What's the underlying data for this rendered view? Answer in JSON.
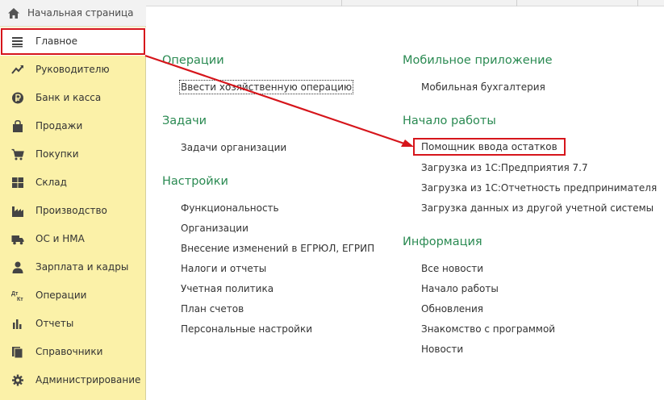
{
  "sidebar": {
    "home": {
      "label": "Начальная страница",
      "icon": "home-icon"
    },
    "items": [
      {
        "label": "Главное",
        "icon": "hamburger-menu-icon",
        "active": true
      },
      {
        "label": "Руководителю",
        "icon": "trend-chart-icon"
      },
      {
        "label": "Банк и касса",
        "icon": "ruble-coin-icon"
      },
      {
        "label": "Продажи",
        "icon": "shopping-bag-icon"
      },
      {
        "label": "Покупки",
        "icon": "shopping-cart-icon"
      },
      {
        "label": "Склад",
        "icon": "warehouse-grid-icon"
      },
      {
        "label": "Производство",
        "icon": "factory-icon"
      },
      {
        "label": "ОС и НМА",
        "icon": "truck-icon"
      },
      {
        "label": "Зарплата и кадры",
        "icon": "person-icon"
      },
      {
        "label": "Операции",
        "icon": "debit-credit-icon",
        "icon_text": {
          "dt": "Дт",
          "kt": "Кт"
        }
      },
      {
        "label": "Отчеты",
        "icon": "bar-chart-icon"
      },
      {
        "label": "Справочники",
        "icon": "books-icon"
      },
      {
        "label": "Администрирование",
        "icon": "gear-icon"
      }
    ]
  },
  "main": {
    "left_sections": [
      {
        "title": "Операции",
        "links": [
          "Ввести хозяйственную операцию"
        ]
      },
      {
        "title": "Задачи",
        "links": [
          "Задачи организации"
        ]
      },
      {
        "title": "Настройки",
        "links": [
          "Функциональность",
          "Организации",
          "Внесение изменений в ЕГРЮЛ, ЕГРИП",
          "Налоги и отчеты",
          "Учетная политика",
          "План счетов",
          "Персональные настройки"
        ]
      }
    ],
    "right_sections": [
      {
        "title": "Мобильное приложение",
        "links": [
          "Мобильная бухгалтерия"
        ]
      },
      {
        "title": "Начало работы",
        "links": [
          "Помощник ввода остатков",
          "Загрузка из 1С:Предприятия 7.7",
          "Загрузка из 1С:Отчетность предпринимателя",
          "Загрузка данных из другой учетной системы"
        ]
      },
      {
        "title": "Информация",
        "links": [
          "Все новости",
          "Начало работы",
          "Обновления",
          "Знакомство с программой",
          "Новости"
        ]
      }
    ]
  },
  "highlight": {
    "color": "#d6151b"
  },
  "colors": {
    "sidebar_bg": "#fbf1a8",
    "section_title": "#2a8a52"
  }
}
